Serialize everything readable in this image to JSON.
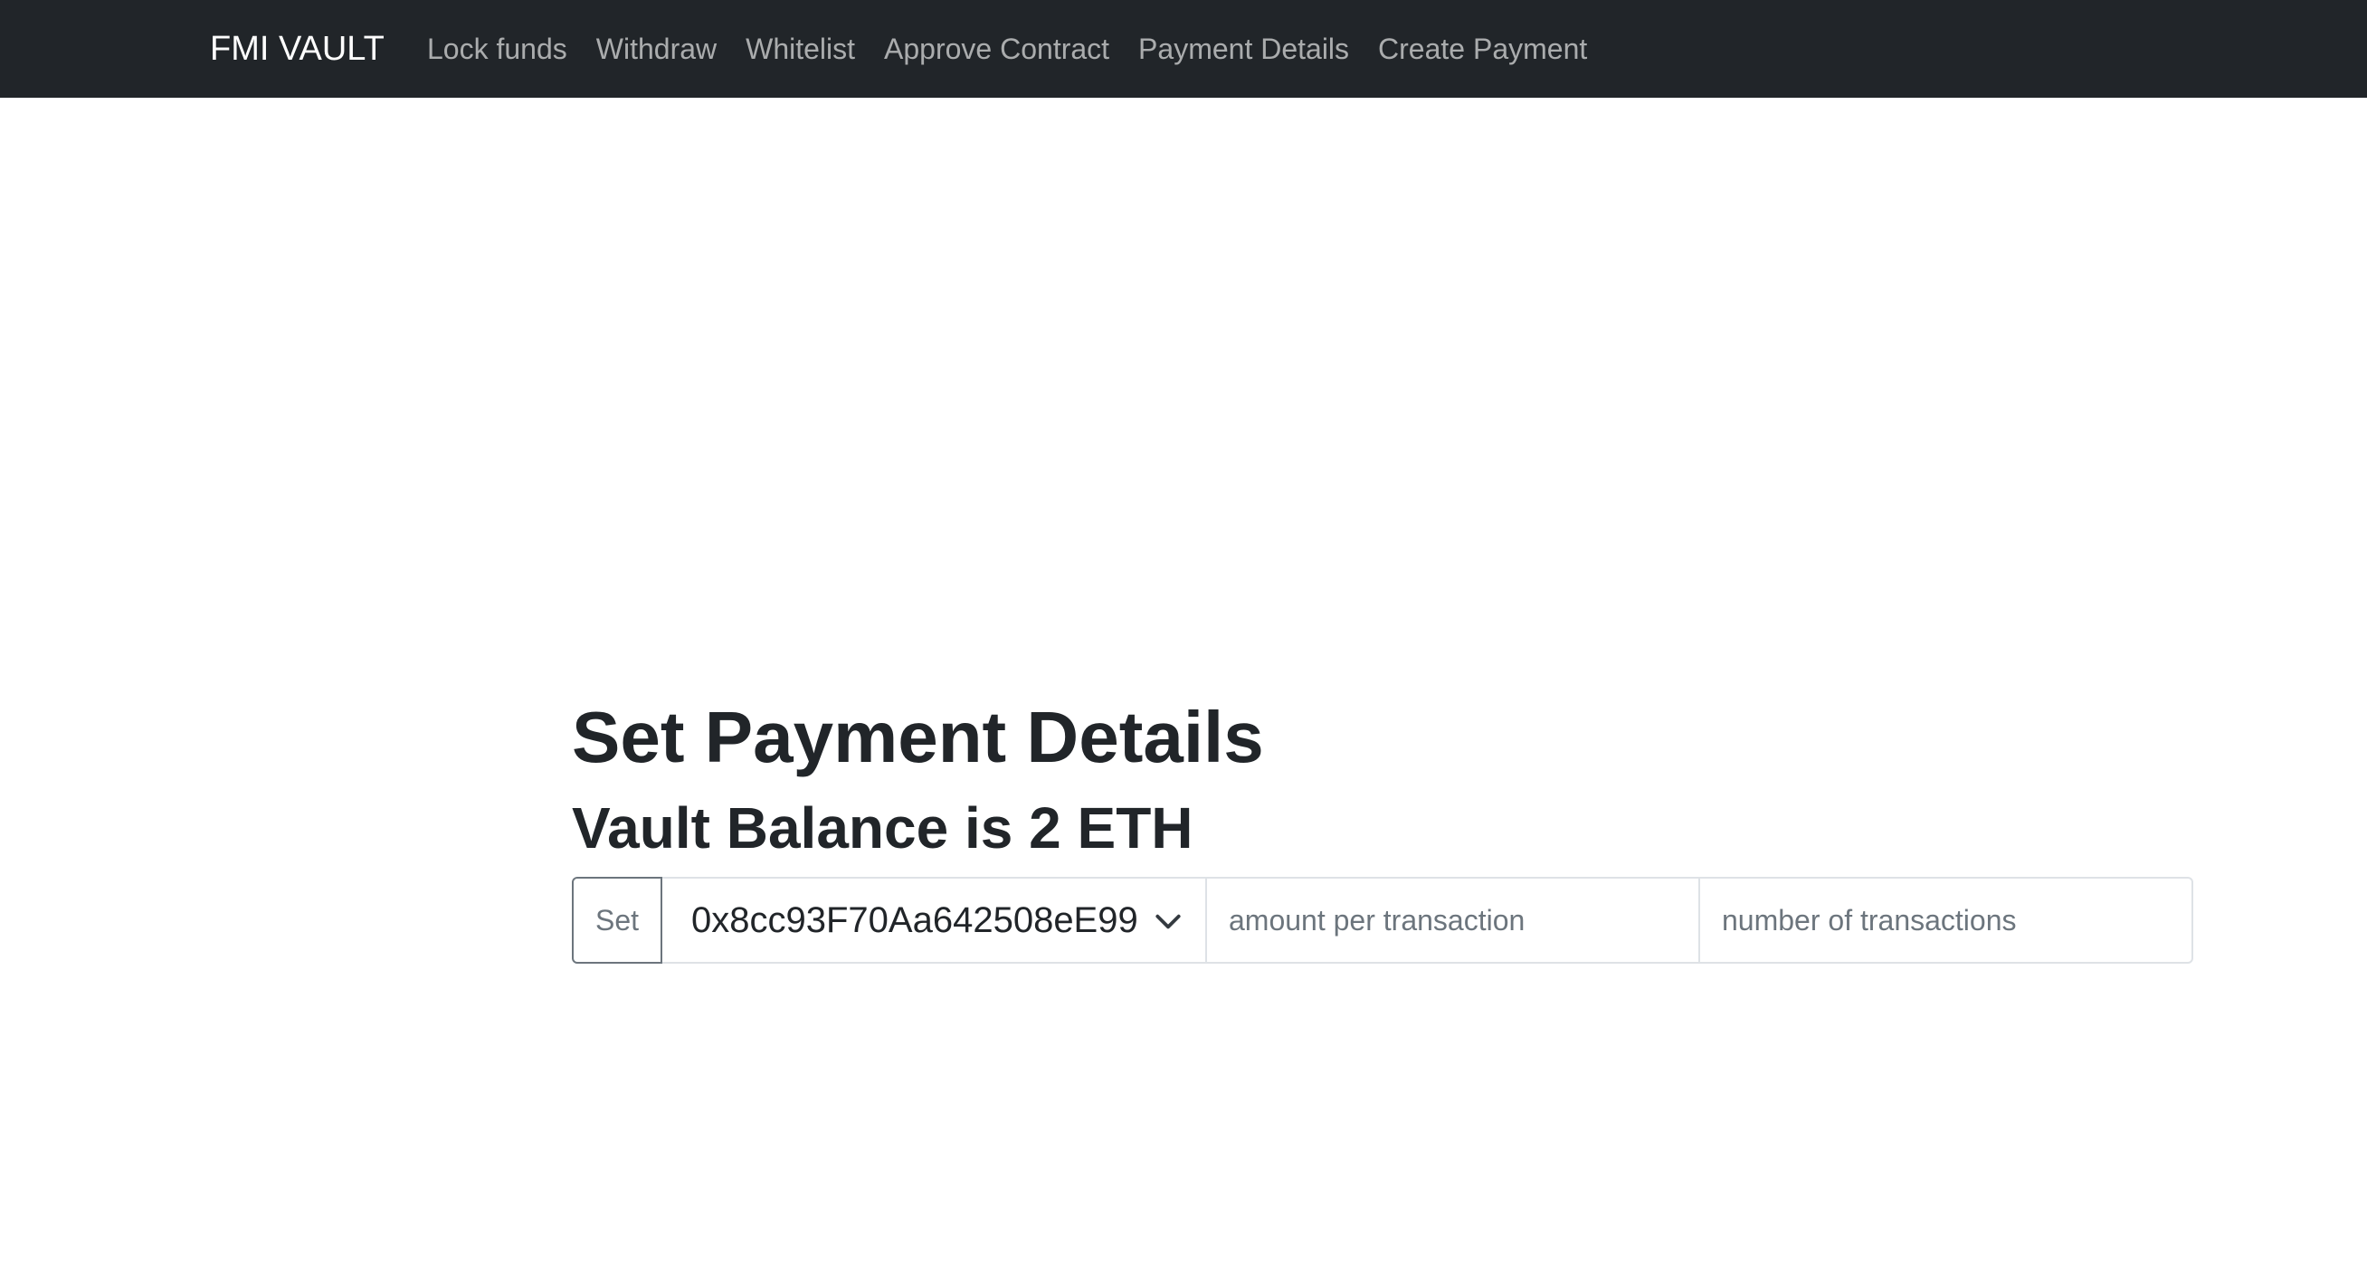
{
  "navbar": {
    "brand": "FMI VAULT",
    "links": [
      {
        "label": "Lock funds"
      },
      {
        "label": "Withdraw"
      },
      {
        "label": "Whitelist"
      },
      {
        "label": "Approve Contract"
      },
      {
        "label": "Payment Details"
      },
      {
        "label": "Create Payment"
      }
    ]
  },
  "main": {
    "title": "Set Payment Details",
    "balance_text": "Vault Balance is 2 ETH",
    "form": {
      "set_button": "Set",
      "selected_address": "0x8cc93F70Aa642508eE99",
      "amount_placeholder": "amount per transaction",
      "count_placeholder": "number of transactions"
    }
  },
  "icons": {
    "select_arrow": "chevron-down-icon"
  },
  "colors": {
    "navbar_bg": "#212529",
    "nav_link": "rgba(255,255,255,0.55)",
    "text": "#212529",
    "border": "#dee2e6",
    "button_border": "#6c757d"
  }
}
